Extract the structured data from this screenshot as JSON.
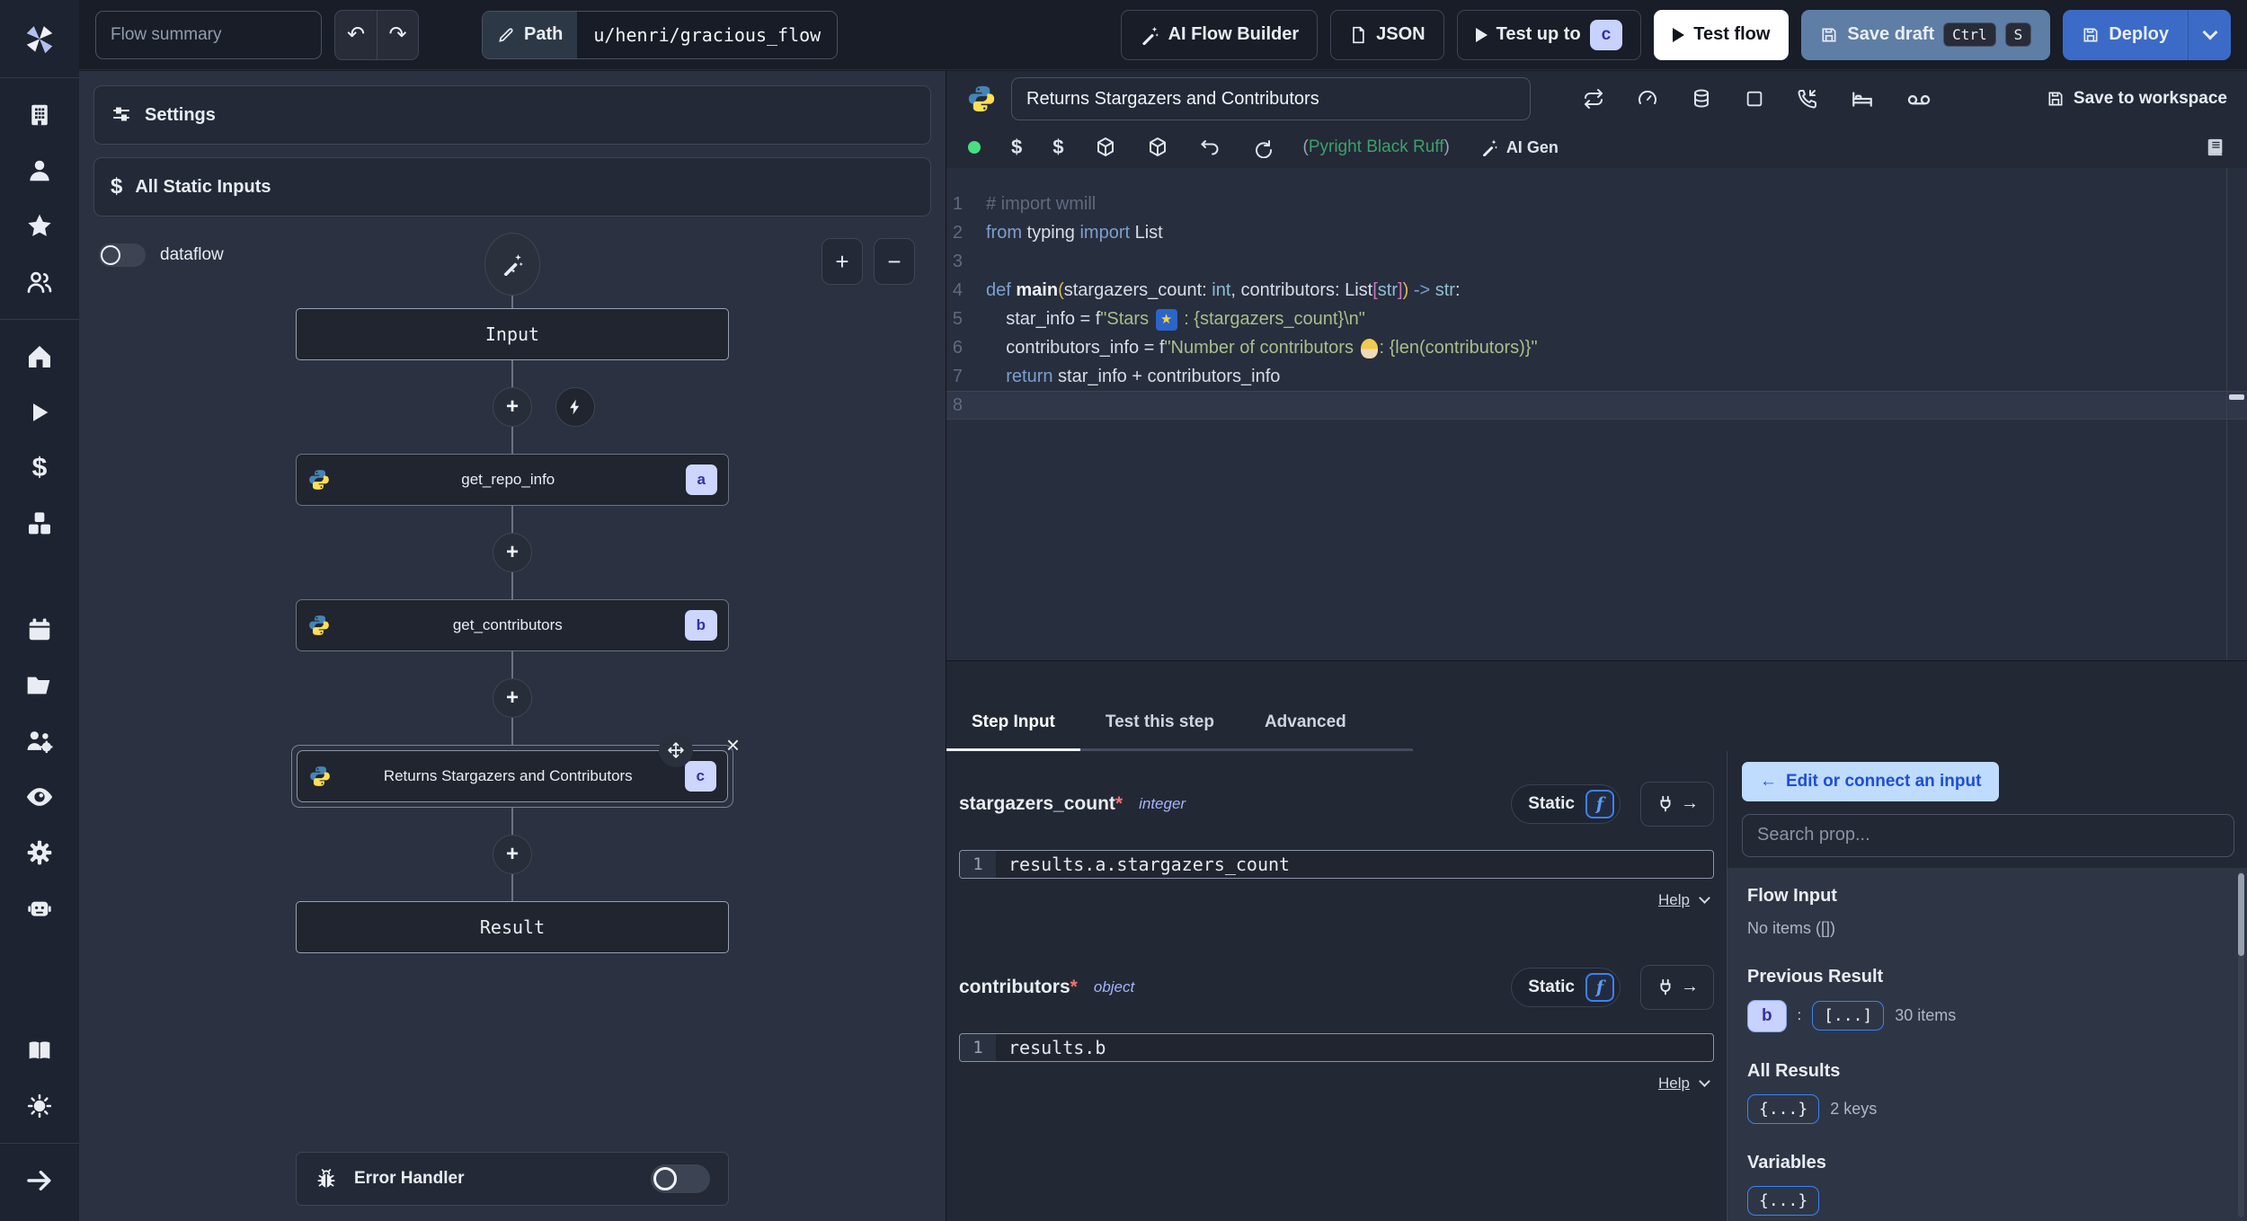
{
  "topbar": {
    "flow_summary_placeholder": "Flow summary",
    "path_label": "Path",
    "path_value": "u/henri/gracious_flow",
    "ai_flow_builder": "AI Flow Builder",
    "json_label": "JSON",
    "test_up_to": "Test up to",
    "test_up_to_badge": "c",
    "test_flow": "Test flow",
    "save_draft": "Save draft",
    "kbd_ctrl": "Ctrl",
    "kbd_s": "S",
    "deploy": "Deploy"
  },
  "left_panel": {
    "settings": "Settings",
    "all_static_inputs": "All Static Inputs",
    "dataflow": "dataflow",
    "zoom_in": "+",
    "zoom_out": "−",
    "graph": {
      "input": "Input",
      "nodes": [
        {
          "label": "get_repo_info",
          "badge": "a"
        },
        {
          "label": "get_contributors",
          "badge": "b"
        },
        {
          "label": "Returns Stargazers and Contributors",
          "badge": "c"
        }
      ],
      "result": "Result",
      "close_glyph": "×",
      "plus_glyph": "+"
    },
    "error_handler": "Error Handler"
  },
  "editor": {
    "title": "Returns Stargazers and Contributors",
    "save_to_workspace": "Save to workspace",
    "lint_open": "(",
    "lint_text": "Pyright Black Ruff",
    "lint_close": ")",
    "ai_gen": "AI Gen",
    "emoji_star": "🌠",
    "emoji_worker": "👷",
    "active_line": 8,
    "code": [
      [
        {
          "t": "# import wmill",
          "c": "cmt"
        }
      ],
      [
        {
          "t": "from",
          "c": "kw"
        },
        {
          "t": " typing ",
          "c": "tx"
        },
        {
          "t": "import",
          "c": "kw"
        },
        {
          "t": " List",
          "c": "tx"
        }
      ],
      [],
      [
        {
          "t": "def",
          "c": "kw"
        },
        {
          "t": " ",
          "c": "tx"
        },
        {
          "t": "main",
          "c": "fn"
        },
        {
          "t": "(",
          "c": "par"
        },
        {
          "t": "stargazers_count: ",
          "c": "tx"
        },
        {
          "t": "int",
          "c": "type"
        },
        {
          "t": ", contributors: List",
          "c": "tx"
        },
        {
          "t": "[",
          "c": "mag"
        },
        {
          "t": "str",
          "c": "type"
        },
        {
          "t": "]",
          "c": "mag"
        },
        {
          "t": ")",
          "c": "par"
        },
        {
          "t": " ",
          "c": "tx"
        },
        {
          "t": "->",
          "c": "kw"
        },
        {
          "t": " ",
          "c": "tx"
        },
        {
          "t": "str",
          "c": "type"
        },
        {
          "t": ":",
          "c": "tx"
        }
      ],
      [
        {
          "t": "    star_info = f",
          "c": "tx"
        },
        {
          "t": "\"Stars ",
          "c": "str"
        },
        {
          "e": "star"
        },
        {
          "t": " : {stargazers_count}\\n\"",
          "c": "str"
        }
      ],
      [
        {
          "t": "    contributors_info = f",
          "c": "tx"
        },
        {
          "t": "\"Number of contributors ",
          "c": "str"
        },
        {
          "e": "worker"
        },
        {
          "t": ": {len(contributors)}\"",
          "c": "str"
        }
      ],
      [
        {
          "t": "    ",
          "c": "tx"
        },
        {
          "t": "return",
          "c": "kw"
        },
        {
          "t": " star_info + contributors_info",
          "c": "tx"
        }
      ],
      []
    ]
  },
  "step_panel": {
    "tabs": [
      {
        "label": "Step Input"
      },
      {
        "label": "Test this step"
      },
      {
        "label": "Advanced"
      }
    ],
    "fields": [
      {
        "name": "stargazers_count",
        "required": "*",
        "type": "integer",
        "mode": "Static",
        "chip": "f",
        "line_no": "1",
        "value": "results.a.stargazers_count",
        "help": "Help"
      },
      {
        "name": "contributors",
        "required": "*",
        "type": "object",
        "mode": "Static",
        "chip": "f",
        "line_no": "1",
        "value": "results.b",
        "help": "Help"
      }
    ]
  },
  "prop_panel": {
    "edit_connect_arrow": "←",
    "edit_connect": "Edit or connect an input",
    "search_placeholder": "Search prop...",
    "sections": [
      {
        "title": "Flow Input",
        "empty": "No items ([])"
      },
      {
        "title": "Previous Result",
        "key": "b",
        "colon": ":",
        "collapsed": "[...]",
        "count": "30 items"
      },
      {
        "title": "All Results",
        "collapsed": "{...}",
        "count": "2 keys"
      },
      {
        "title": "Variables",
        "collapsed": "{...}"
      }
    ]
  },
  "colors": {
    "accent_blue": "#3b82f6",
    "deploy_blue": "#3b6bc7",
    "save_draft_slate": "#5e7ea6",
    "badge_lavender": "#c7d2fe",
    "badge_indigo_text": "#3730a3",
    "status_green": "#4ade80",
    "lint_green": "#3fa068",
    "required_red": "#f87171",
    "edit_connect_bg": "#bfdbfe",
    "edit_connect_text": "#1d4ed8"
  }
}
